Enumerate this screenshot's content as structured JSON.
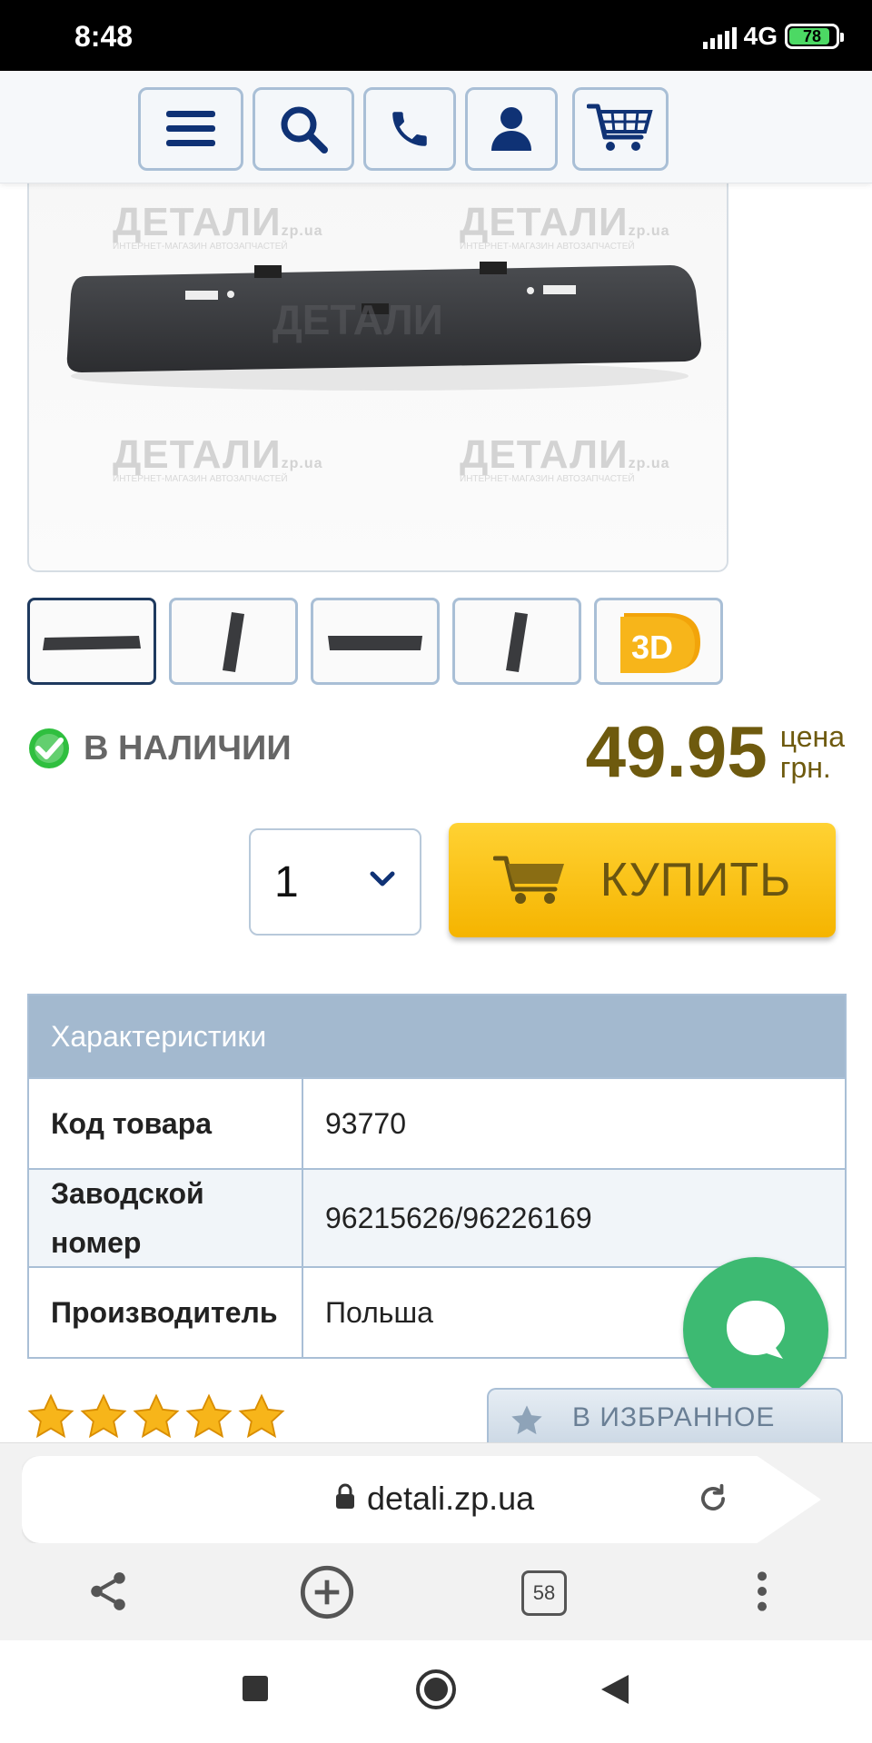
{
  "status_bar": {
    "time": "8:48",
    "network": "4G",
    "battery": "78"
  },
  "nav": {
    "icons": [
      "menu-icon",
      "search-icon",
      "phone-icon",
      "user-icon",
      "cart-icon"
    ]
  },
  "product": {
    "watermark_brand": "ДЕТАЛИ",
    "watermark_domain": "zp.ua",
    "watermark_sub": "ИНТЕРНЕТ-МАГАЗИН АВТОЗАПЧАСТЕЙ",
    "availability": "В НАЛИЧИИ",
    "price": "49.95",
    "price_label": "цена",
    "currency": "грн.",
    "quantity": "1",
    "buy_label": "КУПИТЬ",
    "thumb_3d_label": "3D"
  },
  "specs": {
    "title": "Характеристики",
    "rows": [
      {
        "key": "Код товара",
        "value": "93770"
      },
      {
        "key": "Заводской номер",
        "value": "96215626/96226169"
      },
      {
        "key": "Производитель",
        "value": "Польша"
      }
    ]
  },
  "rating": {
    "stars": 5,
    "max": 5
  },
  "favorites_label": "В ИЗБРАННОЕ",
  "browser": {
    "url": "detali.zp.ua",
    "tabs_count": "58"
  },
  "colors": {
    "accent": "#a9bfd6",
    "price": "#6e5a0e",
    "buy": "#f5b400",
    "chat": "#3dba72",
    "in_stock": "#2fbf3f"
  }
}
